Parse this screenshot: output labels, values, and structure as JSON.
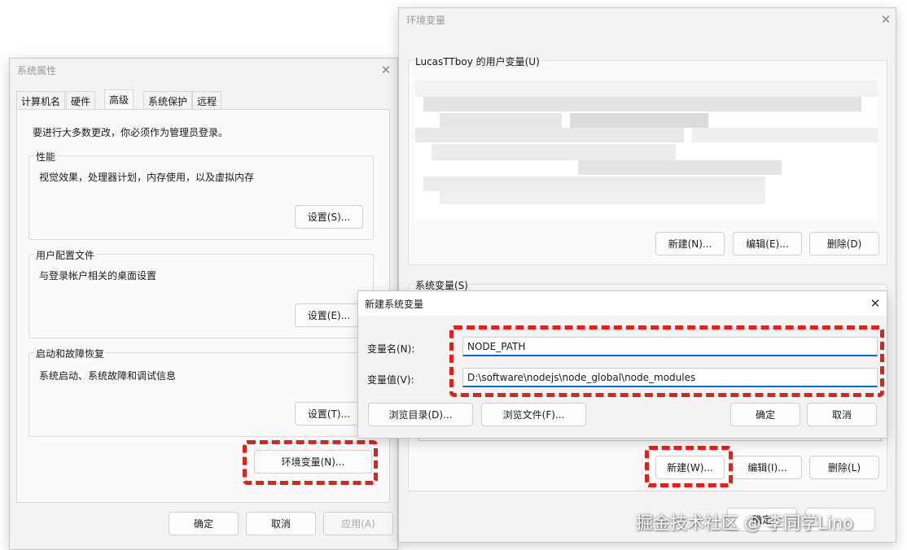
{
  "sysprop": {
    "title": "系统属性",
    "tabs": [
      "计算机名",
      "硬件",
      "高级",
      "系统保护",
      "远程"
    ],
    "notice": "要进行大多数更改，你必须作为管理员登录。",
    "performance": {
      "label": "性能",
      "desc": "视觉效果，处理器计划，内存使用，以及虚拟内存",
      "button": "设置(S)..."
    },
    "profile": {
      "label": "用户配置文件",
      "desc": "与登录帐户相关的桌面设置",
      "button": "设置(E)..."
    },
    "startup": {
      "label": "启动和故障恢复",
      "desc": "系统启动、系统故障和调试信息",
      "button": "设置(T)..."
    },
    "env_button": "环境变量(N)...",
    "ok": "确定",
    "cancel": "取消",
    "apply": "应用(A)"
  },
  "envvars": {
    "title": "环境变量",
    "user_group": "LucasTTboy 的用户变量(U)",
    "user_new": "新建(N)...",
    "user_edit": "编辑(E)...",
    "user_delete": "删除(D)",
    "sys_group": "系统变量(S)",
    "sys_new": "新建(W)...",
    "sys_edit": "编辑(I)...",
    "sys_delete": "删除(L)",
    "ok": "确定"
  },
  "newvar": {
    "title": "新建系统变量",
    "name_label": "变量名(N):",
    "name_value": "NODE_PATH",
    "value_label": "变量值(V):",
    "value_value": "D:\\software\\nodejs\\node_global\\node_modules",
    "browse_dir": "浏览目录(D)...",
    "browse_file": "浏览文件(F)...",
    "ok": "确定",
    "cancel": "取消"
  },
  "watermark": "掘金技术社区 @ 李同学Lino",
  "colors": {
    "highlight": "#e0221b",
    "focus": "#0a6cc8"
  },
  "icons": {
    "close": "close-icon"
  }
}
